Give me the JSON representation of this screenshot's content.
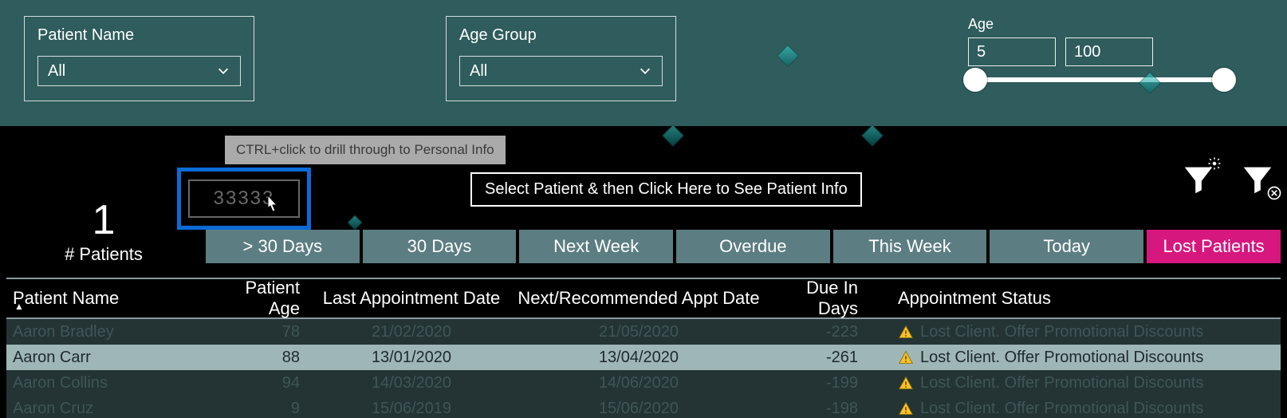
{
  "filters": {
    "patient_name": {
      "label": "Patient Name",
      "value": "All"
    },
    "age_group": {
      "label": "Age Group",
      "value": "All"
    },
    "age": {
      "label": "Age",
      "min": "5",
      "max": "100"
    }
  },
  "tooltip": "CTRL+click to drill through to Personal Info",
  "drill_value": "33333",
  "count": {
    "value": "1",
    "label": "# Patients"
  },
  "patient_info_button": "Select Patient & then Click Here to See Patient Info",
  "tabs": [
    "> 30 Days",
    "30 Days",
    "Next Week",
    "Overdue",
    "This Week",
    "Today",
    "Lost Patients"
  ],
  "columns": {
    "name": "Patient Name",
    "age": "Patient Age",
    "last": "Last Appointment Date",
    "next": "Next/Recommended Appt Date",
    "due": "Due In Days",
    "status": "Appointment Status"
  },
  "status_text": "Lost Client. Offer Promotional Discounts",
  "rows": [
    {
      "name": "Aaron Bradley",
      "age": "78",
      "last": "21/02/2020",
      "next": "21/05/2020",
      "due": "-223",
      "sel": false
    },
    {
      "name": "Aaron Carr",
      "age": "88",
      "last": "13/01/2020",
      "next": "13/04/2020",
      "due": "-261",
      "sel": true
    },
    {
      "name": "Aaron Collins",
      "age": "94",
      "last": "14/03/2020",
      "next": "14/06/2020",
      "due": "-199",
      "sel": false
    },
    {
      "name": "Aaron Cruz",
      "age": "9",
      "last": "15/06/2019",
      "next": "15/06/2020",
      "due": "-198",
      "sel": false
    }
  ]
}
